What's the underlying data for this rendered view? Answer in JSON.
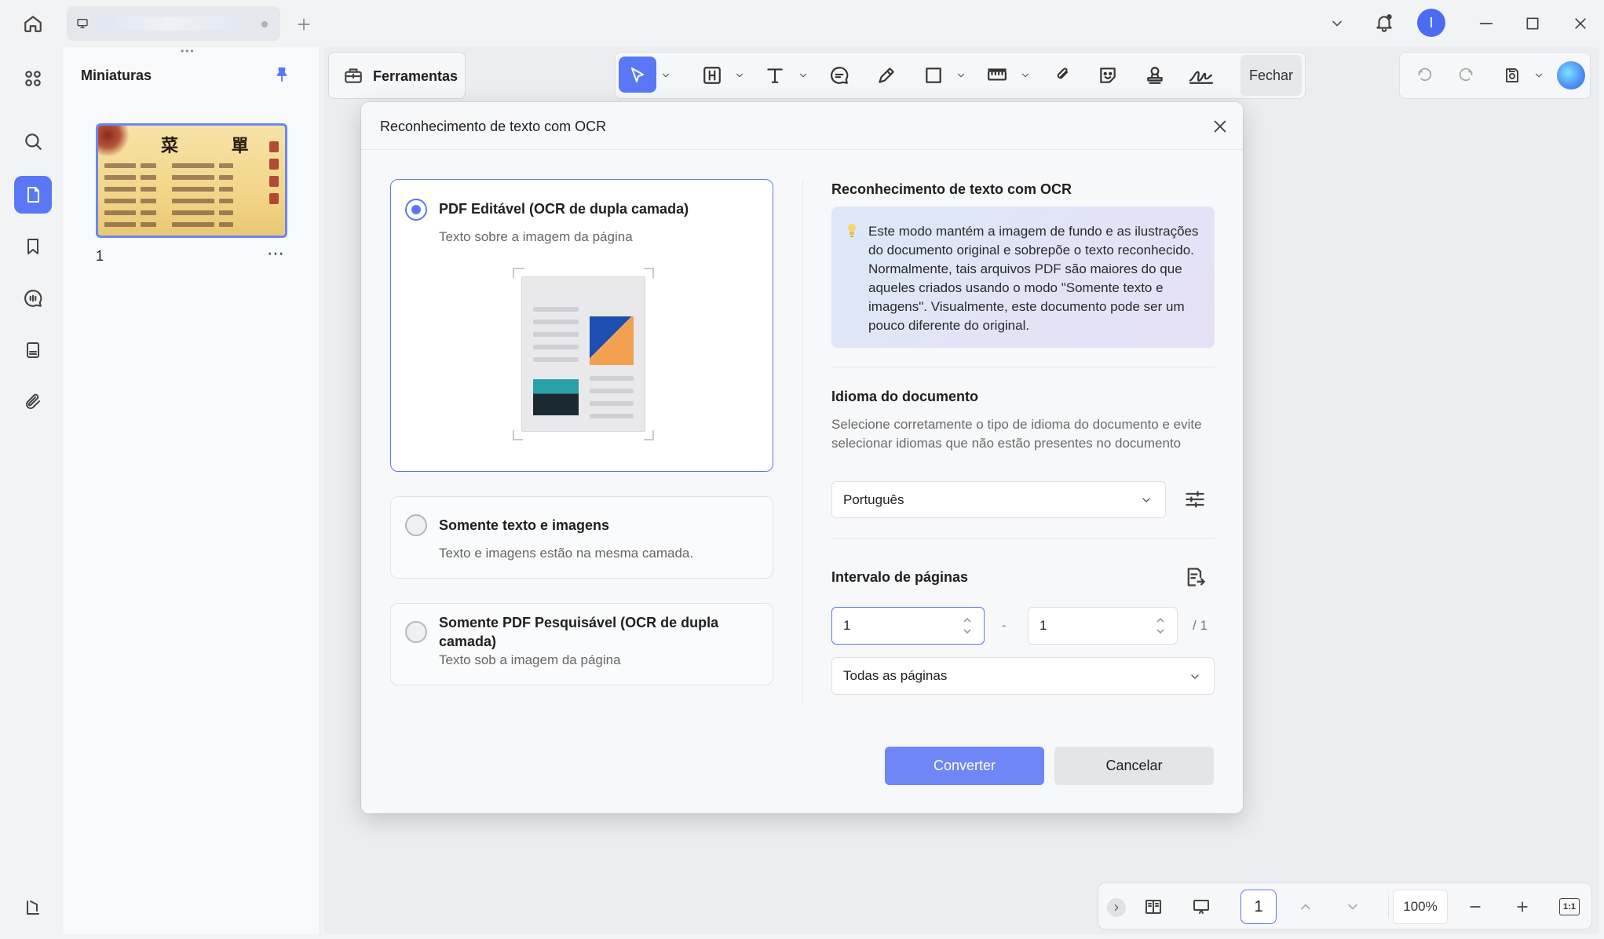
{
  "thumbnails": {
    "title": "Miniaturas",
    "page_number": "1",
    "more": "⋯",
    "thumb_title": "菜 單",
    "thumb_side": "欢迎光临"
  },
  "toolbar": {
    "tools_label": "Ferramentas",
    "close_label": "Fechar"
  },
  "dialog": {
    "title": "Reconhecimento de texto com OCR",
    "options": [
      {
        "title": "PDF Editável (OCR de dupla camada)",
        "subtitle": "Texto sobre a imagem da página",
        "selected": true
      },
      {
        "title": "Somente texto e imagens",
        "subtitle": "Texto e imagens estão na mesma camada.",
        "selected": false
      },
      {
        "title": "Somente PDF Pesquisável (OCR de dupla camada)",
        "subtitle": "Texto sob a imagem da página",
        "selected": false
      }
    ],
    "info_title": "Reconhecimento de texto com OCR",
    "info_text": "Este modo mantém a imagem de fundo e as ilustrações do documento original e sobrepõe o texto reconhecido. Normalmente, tais arquivos PDF são maiores do que aqueles criados usando o modo \"Somente texto e imagens\". Visualmente, este documento pode ser um pouco diferente do original.",
    "language_title": "Idioma do documento",
    "language_desc": "Selecione corretamente o tipo de idioma do documento e evite selecionar idiomas que não estão presentes no documento",
    "language_value": "Português",
    "range_title": "Intervalo de páginas",
    "range_from": "1",
    "range_dash": "-",
    "range_to": "1",
    "range_total": "/ 1",
    "range_mode": "Todas as páginas",
    "convert_label": "Converter",
    "cancel_label": "Cancelar"
  },
  "bottombar": {
    "page": "1",
    "zoom": "100%",
    "fit": "1:1"
  },
  "user": {
    "avatar_initial": "I"
  },
  "colors": {
    "accent": "#5a78f5",
    "convert_button": "#6f86f7"
  }
}
